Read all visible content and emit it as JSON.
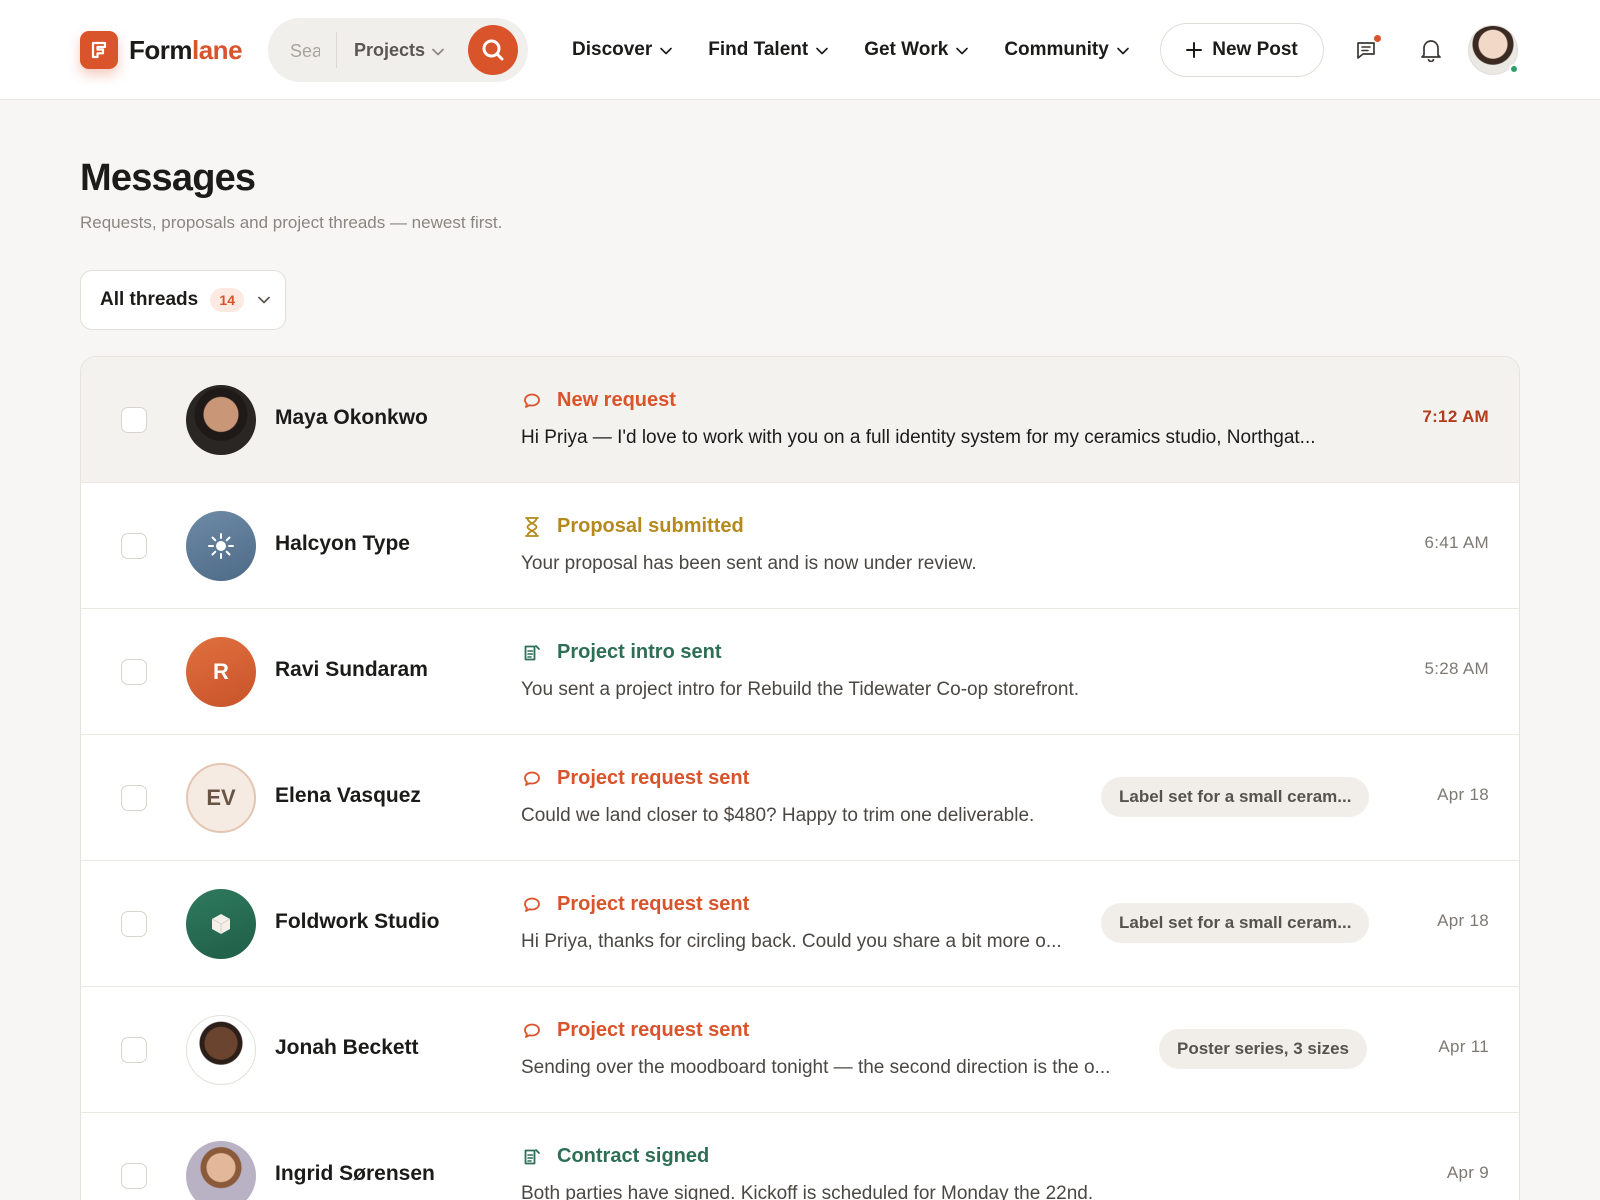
{
  "brand": {
    "name_part1": "Form",
    "name_part2": "lane",
    "accent_color": "#d9532b",
    "logo_icon": "formlane-logo-icon"
  },
  "search": {
    "placeholder": "Search",
    "scope": "Projects"
  },
  "nav": [
    {
      "label": "Discover"
    },
    {
      "label": "Find Talent"
    },
    {
      "label": "Get Work"
    },
    {
      "label": "Community"
    }
  ],
  "header_actions": {
    "new_post": "New Post",
    "message_icon": "message-icon",
    "bell_icon": "bell-icon"
  },
  "page": {
    "title": "Messages",
    "subtitle": "Requests, proposals and project threads — newest first."
  },
  "filter": {
    "label": "All threads",
    "count": "14"
  },
  "threads": [
    {
      "name": "Maya Okonkwo",
      "avatar": "photo",
      "status": "New request",
      "status_kind": "request",
      "preview": "Hi Priya — I'd love to work with you on a full identity system for my ceramics studio, Northgat...",
      "tag": "",
      "time": "7:12 AM",
      "unread": true
    },
    {
      "name": "Halcyon Type",
      "avatar": "sun-logo-icon",
      "status": "Proposal submitted",
      "status_kind": "proposal",
      "preview": "Your proposal has been sent and is now under review.",
      "tag": "",
      "time": "6:41 AM",
      "unread": false
    },
    {
      "name": "Ravi Sundaram",
      "avatar_initials": "R",
      "status": "Project intro sent",
      "status_kind": "document",
      "preview": "You sent a project intro for Rebuild the Tidewater Co-op storefront.",
      "tag": "",
      "time": "5:28 AM",
      "unread": false
    },
    {
      "name": "Elena Vasquez",
      "avatar_initials": "EV",
      "status": "Project request sent",
      "status_kind": "request",
      "preview": "Could we land closer to $480? Happy to trim one deliverable.",
      "tag": "Label set for a small ceram...",
      "time": "Apr 18",
      "unread": false
    },
    {
      "name": "Foldwork Studio",
      "avatar": "cube-logo-icon",
      "status": "Project request sent",
      "status_kind": "request",
      "preview": "Hi Priya, thanks for circling back. Could you share a bit more o...",
      "tag": "Label set for a small ceram...",
      "time": "Apr 18",
      "unread": false
    },
    {
      "name": "Jonah Beckett",
      "avatar": "photo",
      "status": "Project request sent",
      "status_kind": "request",
      "preview": "Sending over the moodboard tonight — the second direction is the o...",
      "tag": "Poster series, 3 sizes",
      "time": "Apr 11",
      "unread": false
    },
    {
      "name": "Ingrid Sørensen",
      "avatar": "photo",
      "status": "Contract signed",
      "status_kind": "document",
      "preview": "Both parties have signed. Kickoff is scheduled for Monday the 22nd.",
      "tag": "",
      "time": "Apr 9",
      "unread": false
    }
  ]
}
